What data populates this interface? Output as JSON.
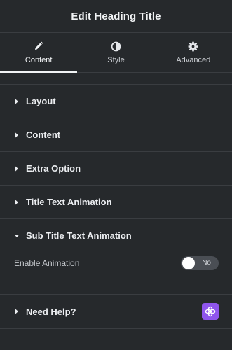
{
  "header": {
    "title": "Edit Heading Title"
  },
  "tabs": [
    {
      "label": "Content",
      "icon": "pencil-icon",
      "active": true
    },
    {
      "label": "Style",
      "icon": "contrast-icon",
      "active": false
    },
    {
      "label": "Advanced",
      "icon": "gear-icon",
      "active": false
    }
  ],
  "sections": [
    {
      "label": "Layout",
      "expanded": false
    },
    {
      "label": "Content",
      "expanded": false
    },
    {
      "label": "Extra Option",
      "expanded": false
    },
    {
      "label": "Title Text Animation",
      "expanded": false
    },
    {
      "label": "Sub Title Text Animation",
      "expanded": true
    }
  ],
  "sub_title_animation": {
    "enable_label": "Enable Animation",
    "toggle_state": "No",
    "toggle_on": false
  },
  "help": {
    "label": "Need Help?",
    "badge_icon": "plugin-logo-icon"
  },
  "colors": {
    "background": "#26292c",
    "divider": "#3a3d41",
    "accent": "#8f55ed"
  }
}
